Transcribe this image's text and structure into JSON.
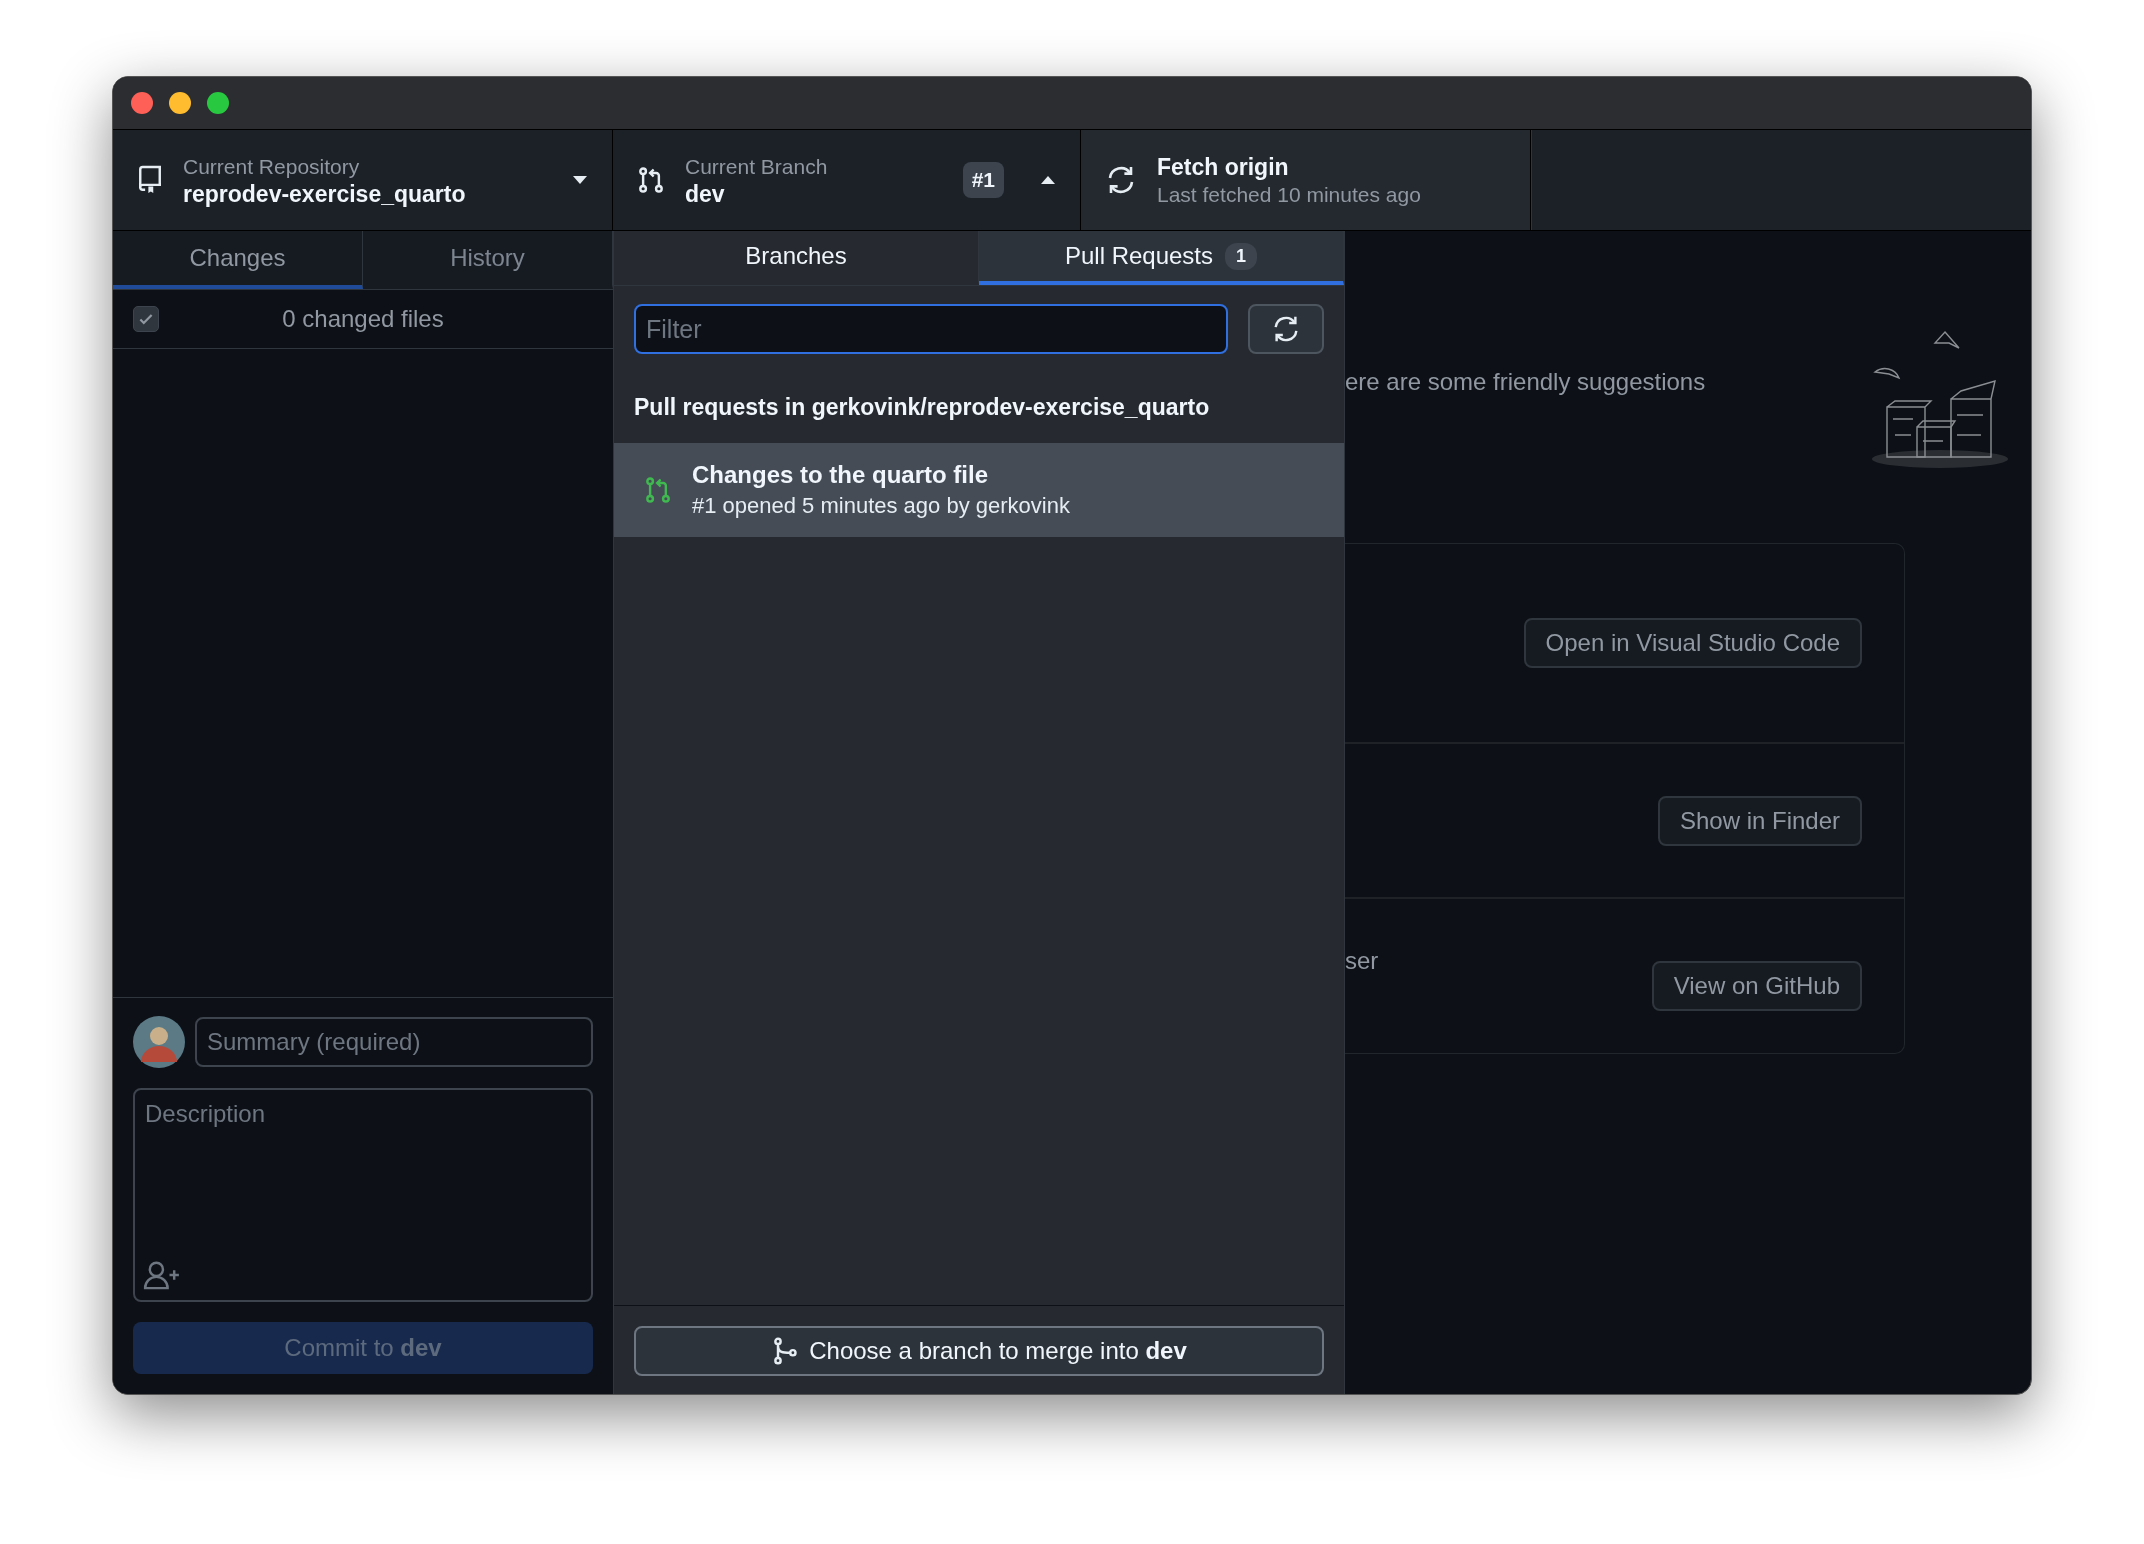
{
  "toolbar": {
    "repository": {
      "label": "Current Repository",
      "name": "reprodev-exercise_quarto"
    },
    "branch": {
      "label": "Current Branch",
      "name": "dev",
      "badge": "#1",
      "menu_open": true
    },
    "fetch": {
      "title": "Fetch origin",
      "subtitle": "Last fetched 10 minutes ago"
    }
  },
  "sidebar": {
    "tabs": [
      {
        "label": "Changes",
        "selected": true
      },
      {
        "label": "History",
        "selected": false
      }
    ],
    "changes": {
      "all_checked": true,
      "summary": "0 changed files"
    },
    "commit": {
      "summary_placeholder": "Summary (required)",
      "description_placeholder": "Description",
      "button": "Commit to **dev**",
      "disabled": true
    }
  },
  "branch_menu": {
    "tabs": [
      {
        "label": "Branches",
        "selected": false
      },
      {
        "label": "Pull Requests",
        "selected": true,
        "count": "1"
      }
    ],
    "filter": {
      "placeholder": "Filter"
    },
    "heading": "Pull requests in gerkovink/reprodev-exercise_quarto",
    "pull_requests": [
      {
        "title": "Changes to the quarto file",
        "subtitle": "#1 opened 5 minutes ago by gerkovink",
        "selected": true
      }
    ],
    "merge_button": "Choose a branch to merge into **dev**"
  },
  "suggestions": {
    "intro": "ere are some friendly suggestions",
    "items": [
      {
        "button": "Open in Visual Studio Code"
      },
      {
        "button": "Show in Finder"
      },
      {
        "text": "ser",
        "button": "View on GitHub"
      }
    ]
  }
}
